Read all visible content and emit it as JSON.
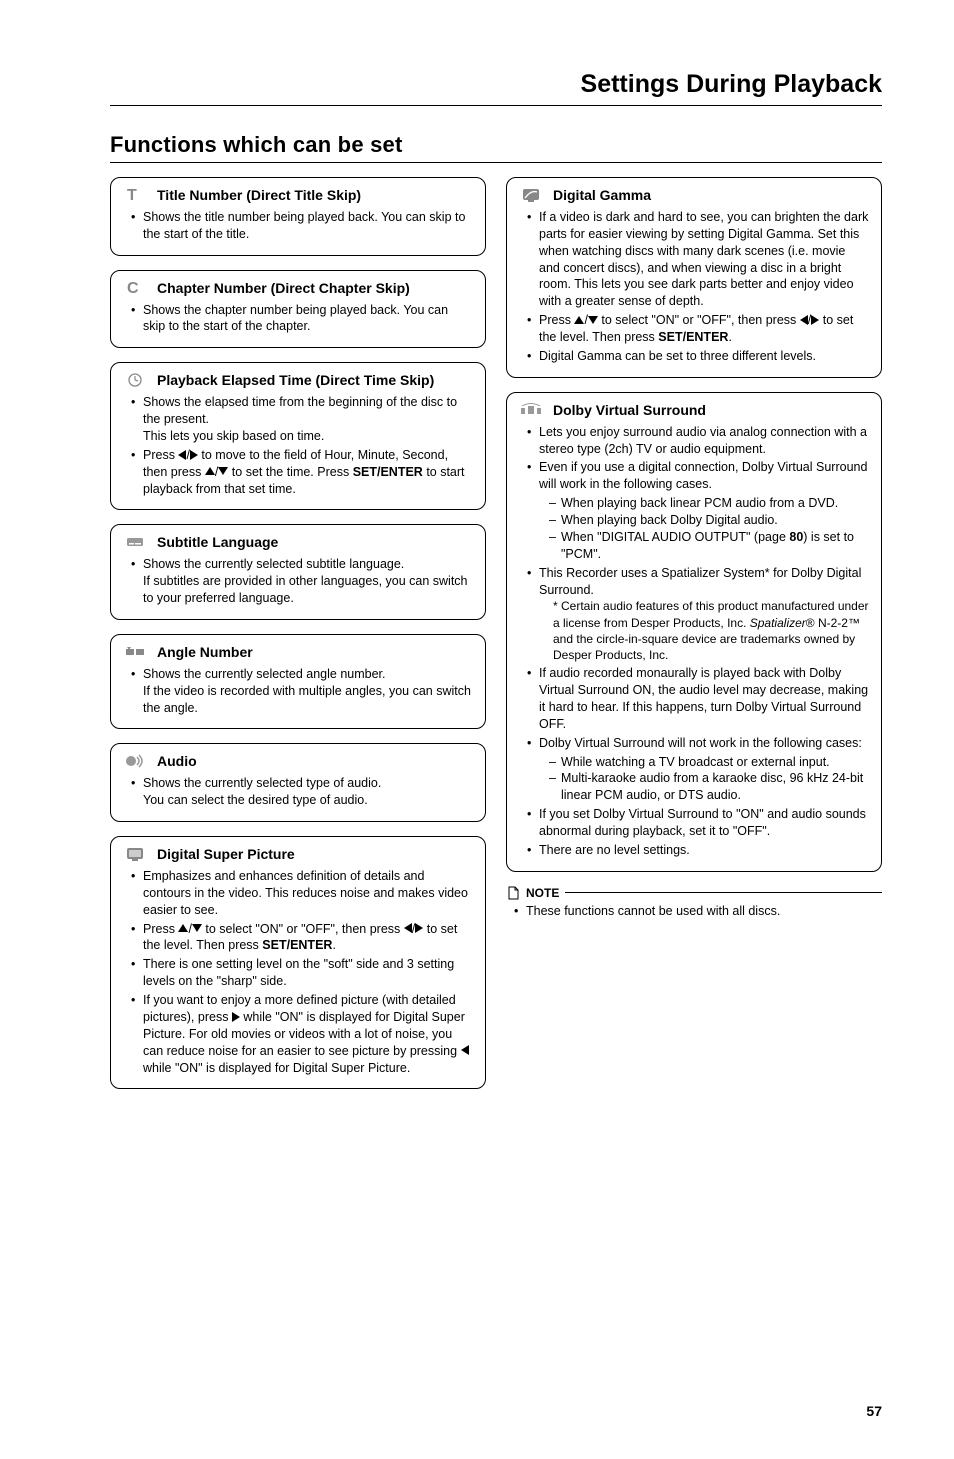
{
  "page_title": "Settings During Playback",
  "section_title": "Functions which can be set",
  "page_number": "57",
  "left": {
    "b1": {
      "title": "Title Number (Direct Title Skip)",
      "i1": "Shows the title number being played back. You can skip to the start of the title."
    },
    "b2": {
      "title": "Chapter Number (Direct Chapter Skip)",
      "i1": "Shows the chapter number being played back. You can skip to the start of the chapter."
    },
    "b3": {
      "title": "Playback Elapsed Time (Direct Time Skip)",
      "i1a": "Shows the elapsed time from the beginning of the disc to the present.",
      "i1b": "This lets you skip based on time.",
      "i2a": "Press ",
      "i2b": " to move to the field of Hour, Minute, Second, then press ",
      "i2c": " to set the time. Press ",
      "i2d": "SET/ENTER",
      "i2e": " to start playback from that set time."
    },
    "b4": {
      "title": "Subtitle Language",
      "i1a": "Shows the currently selected subtitle language.",
      "i1b": "If subtitles are provided in other languages, you can switch to your preferred language."
    },
    "b5": {
      "title": "Angle Number",
      "i1a": "Shows the currently selected angle number.",
      "i1b": "If the video is recorded with multiple angles, you can switch the angle."
    },
    "b6": {
      "title": "Audio",
      "i1a": "Shows the currently selected type of audio.",
      "i1b": "You can select the desired type of audio."
    },
    "b7": {
      "title": "Digital Super Picture",
      "i1": "Emphasizes and enhances definition of details and contours in the video. This reduces noise and makes video easier to see.",
      "i2a": "Press ",
      "i2b": " to select \"ON\" or \"OFF\", then press ",
      "i2c": " to set the level. Then press ",
      "i2d": "SET/ENTER",
      "i2e": ".",
      "i3": "There is one setting level on the \"soft\" side and 3 setting levels on the \"sharp\" side.",
      "i4a": "If you want to enjoy a more defined picture (with detailed pictures), press ",
      "i4b": " while \"ON\" is displayed for Digital Super Picture. For old movies or videos with a lot of noise, you can reduce noise for an easier to see picture by pressing ",
      "i4c": " while \"ON\" is displayed for Digital Super Picture."
    }
  },
  "right": {
    "b1": {
      "title": "Digital Gamma",
      "i1": "If a video is dark and hard to see, you can brighten the dark parts for easier viewing by setting Digital Gamma. Set this when watching discs with many dark scenes (i.e. movie and concert discs), and when viewing a disc in a bright room. This lets you see dark parts better and enjoy video with a greater sense of depth.",
      "i2a": "Press ",
      "i2b": " to select \"ON\" or \"OFF\", then press ",
      "i2c": " to set the level. Then press ",
      "i2d": "SET/ENTER",
      "i2e": ".",
      "i3": "Digital Gamma can be set to three different levels."
    },
    "b2": {
      "title": "Dolby Virtual Surround",
      "i1": "Lets you enjoy surround audio via analog connection with a stereo type (2ch) TV or audio equipment.",
      "i2": "Even if you use a digital connection, Dolby Virtual Surround will work in the following cases.",
      "d1": "When playing back linear PCM audio from a DVD.",
      "d2": "When playing back Dolby Digital audio.",
      "d3a": "When \"DIGITAL AUDIO OUTPUT\" (page ",
      "d3b": "80",
      "d3c": ") is set to \"PCM\".",
      "i3": "This Recorder uses a Spatializer System* for Dolby Digital Surround.",
      "fna": "* Certain audio features of this product manufactured under a license from Desper Products, Inc. ",
      "fnb": "Spatializer",
      "fnc": "® N-2-2™ and the circle-in-square device are trademarks owned by Desper Products, Inc.",
      "i4": "If audio recorded monaurally is played back with Dolby Virtual Surround ON, the audio level may decrease, making it hard to hear. If this happens, turn Dolby Virtual Surround OFF.",
      "i5": "Dolby Virtual Surround will not work in the following cases:",
      "d4": "While watching a TV broadcast or external input.",
      "d5": "Multi-karaoke audio from a karaoke disc, 96 kHz 24-bit linear PCM audio, or DTS audio.",
      "i6": "If you set Dolby Virtual Surround to \"ON\" and audio sounds abnormal during playback, set it to \"OFF\".",
      "i7": "There are no level settings."
    },
    "note": {
      "label": "NOTE",
      "i1": "These functions cannot be used with all discs."
    }
  }
}
